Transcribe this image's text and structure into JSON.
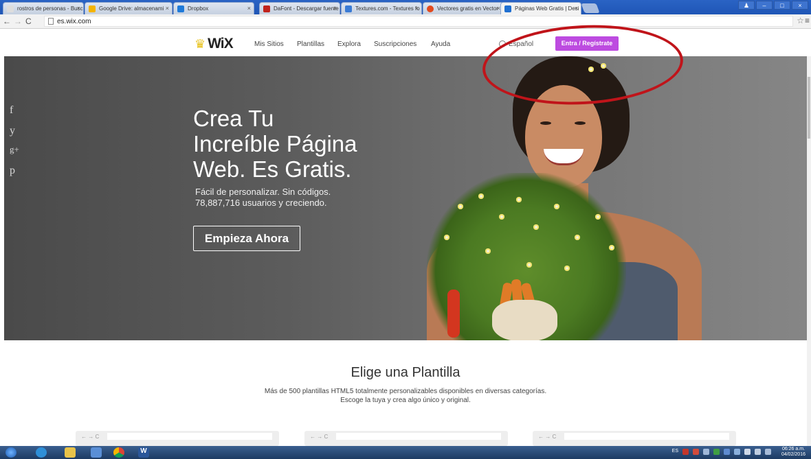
{
  "browser": {
    "tabs": [
      {
        "label": "rostros de personas - Busc",
        "color": "#d2d2d2"
      },
      {
        "label": "Google Drive: almacenami",
        "color": "#f4b400"
      },
      {
        "label": "Dropbox",
        "color": "#1f7ad9"
      },
      {
        "label": "DaFont - Descargar fuente",
        "color": "#c0231c"
      },
      {
        "label": "Textures.com - Textures fo",
        "color": "#3a7bd5"
      },
      {
        "label": "Vectores gratis en Vector",
        "color": "#e24a1e"
      },
      {
        "label": "Páginas Web Gratis | Desi",
        "color": "#1f6fd1",
        "active": true
      }
    ],
    "url": "es.wix.com"
  },
  "header": {
    "logo": "WiX",
    "nav": [
      "Mis Sitios",
      "Plantillas",
      "Explora",
      "Suscripciones",
      "Ayuda"
    ],
    "language": "Español",
    "signin": "Entra / Regístrate",
    "accent": "#bd4be0",
    "annotation_color": "#c0141a"
  },
  "hero": {
    "social": [
      "f",
      "y",
      "g+",
      "p"
    ],
    "headline": [
      "Crea Tu",
      "Increíble Página",
      "Web. Es Gratis."
    ],
    "subline1": "Fácil de personalizar. Sin códigos.",
    "subline2": "78,887,716 usuarios y creciendo.",
    "button": "Empieza Ahora"
  },
  "templates": {
    "title": "Elige una Plantilla",
    "desc1": "Más de 500 plantillas HTML5 totalmente personalizables disponibles en diversas categorías.",
    "desc2": "Escoge la tuya y crea algo único y original."
  },
  "taskbar": {
    "lang": "ES",
    "time": "06:26 a.m.",
    "date": "04/02/2016"
  }
}
